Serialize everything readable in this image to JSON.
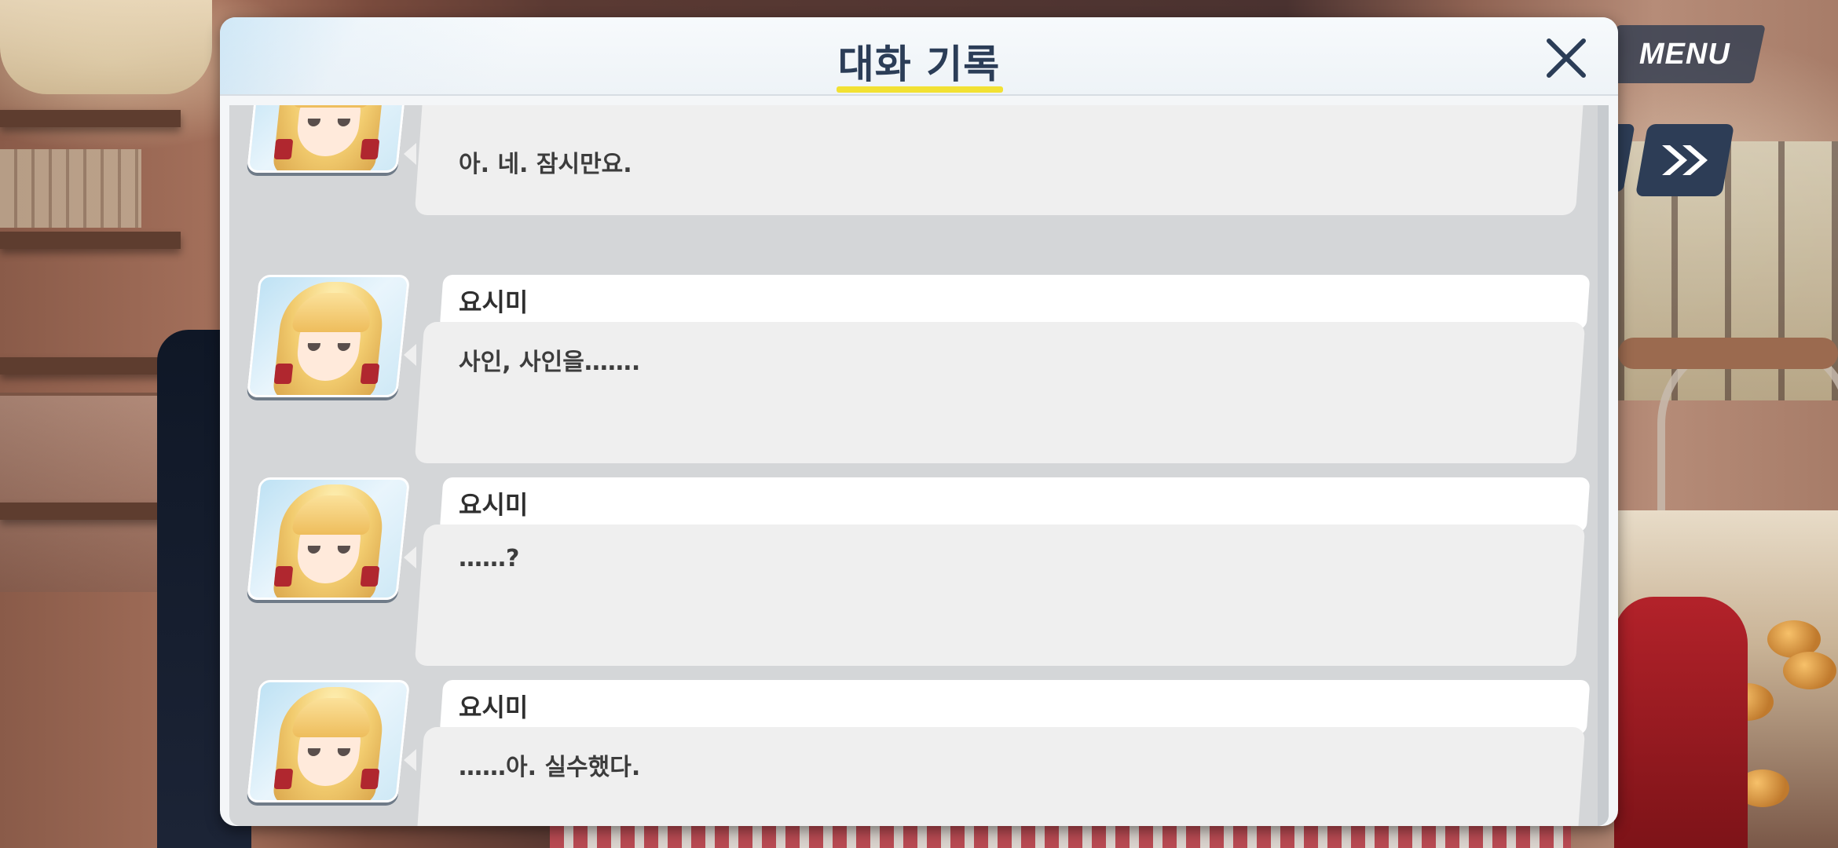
{
  "top_ui": {
    "menu_label": "MENU",
    "skip_icon": "double-chevron-right-icon",
    "auto_icon": "auto-button"
  },
  "dialog": {
    "title": "대화 기록",
    "close_icon": "close-icon",
    "accent_color": "#f2e133",
    "title_color": "#2b3d57"
  },
  "log": [
    {
      "speaker": "",
      "text": "아. 네. 잠시만요."
    },
    {
      "speaker": "요시미",
      "text": "사인, 사인을……."
    },
    {
      "speaker": "요시미",
      "text": "……?"
    },
    {
      "speaker": "요시미",
      "text": "……아. 실수했다."
    }
  ]
}
